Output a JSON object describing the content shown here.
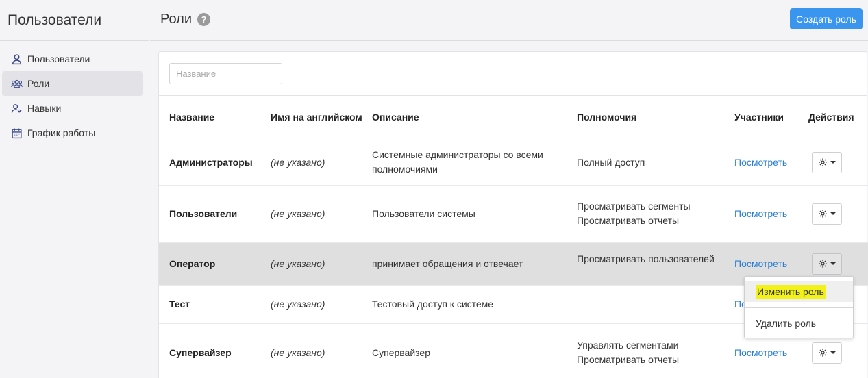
{
  "sidebar": {
    "title": "Пользователи",
    "items": [
      {
        "label": "Пользователи",
        "icon": "user-icon"
      },
      {
        "label": "Роли",
        "icon": "users-group-icon"
      },
      {
        "label": "Навыки",
        "icon": "user-skill-icon"
      },
      {
        "label": "График работы",
        "icon": "calendar-icon"
      }
    ]
  },
  "header": {
    "title": "Роли",
    "help_icon": "?",
    "create_button": "Создать роль"
  },
  "filter": {
    "placeholder": "Название"
  },
  "table": {
    "columns": [
      "Название",
      "Имя на английском",
      "Описание",
      "Полномочия",
      "Участники",
      "Действия"
    ],
    "rows": [
      {
        "name": "Администраторы",
        "english": "(не указано)",
        "description": "Системные администраторы со всеми полномочиями",
        "permissions": [
          "Полный доступ"
        ],
        "members": "Посмотреть"
      },
      {
        "name": "Пользователи",
        "english": "(не указано)",
        "description": "Пользователи системы",
        "permissions": [
          "Просматривать сегменты",
          "Просматривать отчеты"
        ],
        "members": "Посмотреть"
      },
      {
        "name": "Оператор",
        "english": "(не указано)",
        "description": "принимает обращения и отвечает",
        "permissions": [
          "Просматривать пользователей"
        ],
        "members": "Посмотреть"
      },
      {
        "name": "Тест",
        "english": "(не указано)",
        "description": "Тестовый доступ к системе",
        "permissions": [],
        "members": "По"
      },
      {
        "name": "Супервайзер",
        "english": "(не указано)",
        "description": "Супервайзер",
        "permissions": [
          "Управлять сегментами",
          "Просматривать отчеты"
        ],
        "members": "Посмотреть"
      }
    ]
  },
  "dropdown": {
    "edit": "Изменить роль",
    "delete": "Удалить роль"
  },
  "colors": {
    "accent": "#3a95ee",
    "link": "#2a7fd4",
    "highlight": "#f2f21a"
  }
}
